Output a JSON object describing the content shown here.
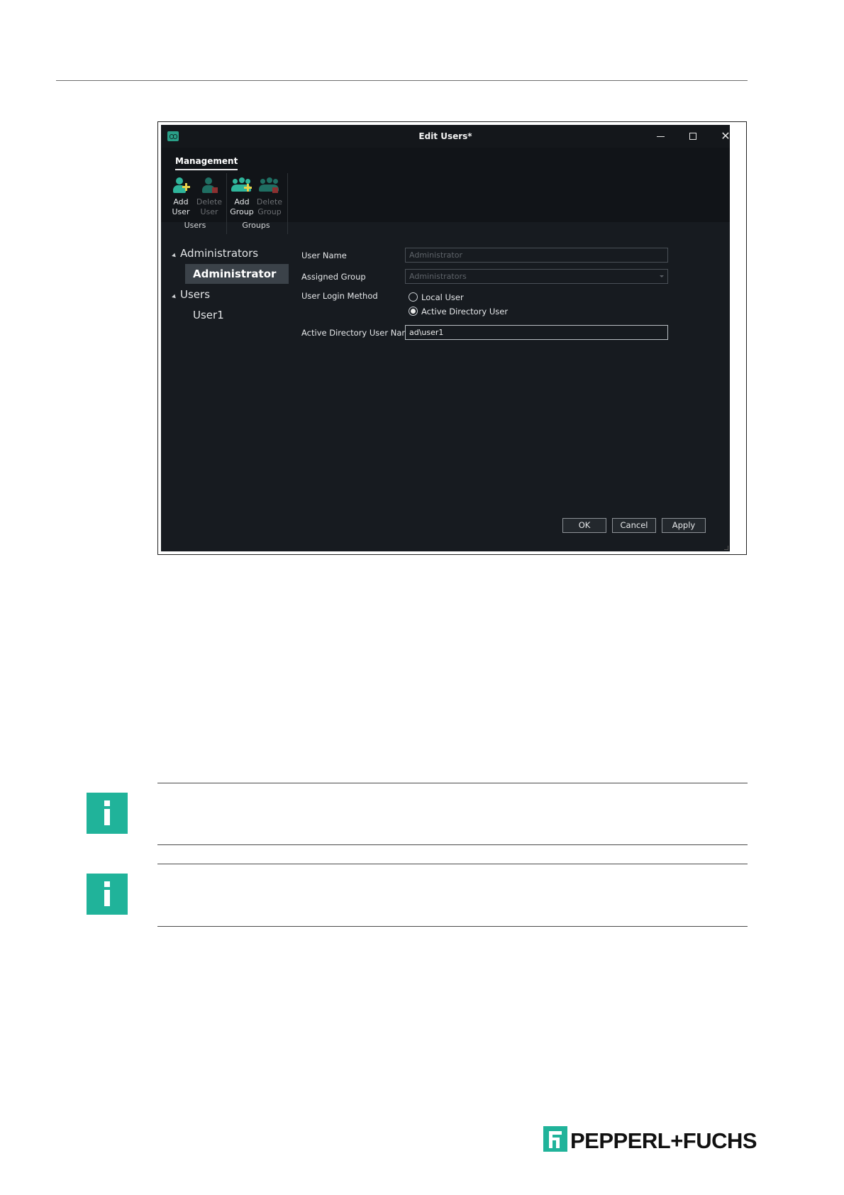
{
  "dialog": {
    "title": "Edit Users*",
    "window_buttons": {
      "minimize": "minimize",
      "maximize": "maximize",
      "close": "✕"
    }
  },
  "ribbon": {
    "tab": "Management",
    "groups": [
      {
        "label": "Users",
        "buttons": [
          {
            "line1": "Add",
            "line2": "User",
            "enabled": true,
            "icon": "add-user-icon"
          },
          {
            "line1": "Delete",
            "line2": "User",
            "enabled": false,
            "icon": "delete-user-icon"
          }
        ]
      },
      {
        "label": "Groups",
        "buttons": [
          {
            "line1": "Add",
            "line2": "Group",
            "enabled": true,
            "icon": "add-group-icon"
          },
          {
            "line1": "Delete",
            "line2": "Group",
            "enabled": false,
            "icon": "delete-group-icon"
          }
        ]
      }
    ]
  },
  "tree": {
    "groups": [
      {
        "name": "Administrators",
        "children": [
          "Administrator"
        ]
      },
      {
        "name": "Users",
        "children": [
          "User1"
        ]
      }
    ],
    "selected": "Administrator"
  },
  "form": {
    "user_name": {
      "label": "User Name",
      "value": "Administrator"
    },
    "assigned_group": {
      "label": "Assigned Group",
      "value": "Administrators"
    },
    "login_method": {
      "label": "User Login Method",
      "options": [
        "Local User",
        "Active Directory User"
      ],
      "selected": "Active Directory User"
    },
    "ad_user_name": {
      "label": "Active Directory User Name",
      "value": "ad\\user1"
    }
  },
  "buttons": {
    "ok": "OK",
    "cancel": "Cancel",
    "apply": "Apply"
  },
  "colors": {
    "accent": "#20b39a",
    "window_bg": "#171b20",
    "ribbon_bg": "#111418",
    "selection": "#3b4249"
  },
  "logo": {
    "text": "PEPPERL+FUCHS"
  }
}
